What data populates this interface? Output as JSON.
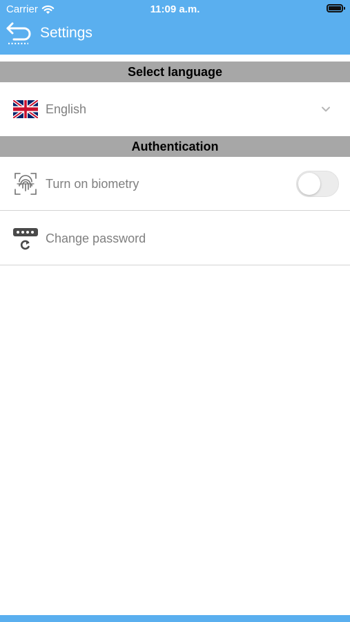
{
  "status_bar": {
    "carrier": "Carrier",
    "time": "11:09 a.m."
  },
  "nav": {
    "title": "Settings",
    "back_icon": "back-arrow-icon"
  },
  "sections": {
    "language_title": "Select language",
    "auth_title": "Authentication"
  },
  "language": {
    "selected": "English",
    "flag_icon": "uk-flag-icon"
  },
  "auth": {
    "biometry_label": "Turn on biometry",
    "biometry_enabled": false,
    "change_password_label": "Change password"
  },
  "colors": {
    "header": "#5aafef",
    "section_header": "#a7a7a7",
    "row_text": "#7f7f7f"
  }
}
